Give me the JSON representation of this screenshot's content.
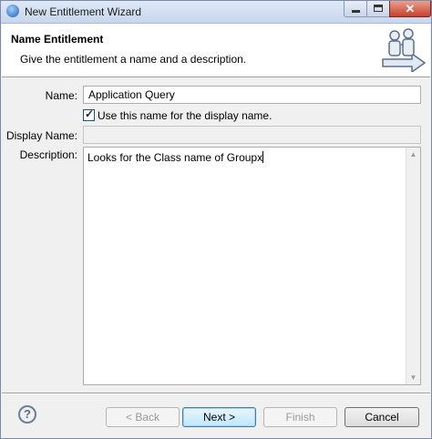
{
  "window": {
    "title": "New Entitlement Wizard",
    "close_glyph": "✕"
  },
  "banner": {
    "title": "Name Entitlement",
    "description": "Give the entitlement a name and a description.",
    "icon": "wizard-people-icon"
  },
  "form": {
    "name_label": "Name:",
    "name_value": "Application Query",
    "use_name_checkbox_label": "Use this name for the display name.",
    "use_name_checked": true,
    "display_name_label": "Display Name:",
    "display_name_value": "",
    "description_label": "Description:",
    "description_value": "Looks for the Class name of Groupx"
  },
  "footer": {
    "help_glyph": "?",
    "back_label": "< Back",
    "next_label": "Next >",
    "finish_label": "Finish",
    "cancel_label": "Cancel"
  }
}
